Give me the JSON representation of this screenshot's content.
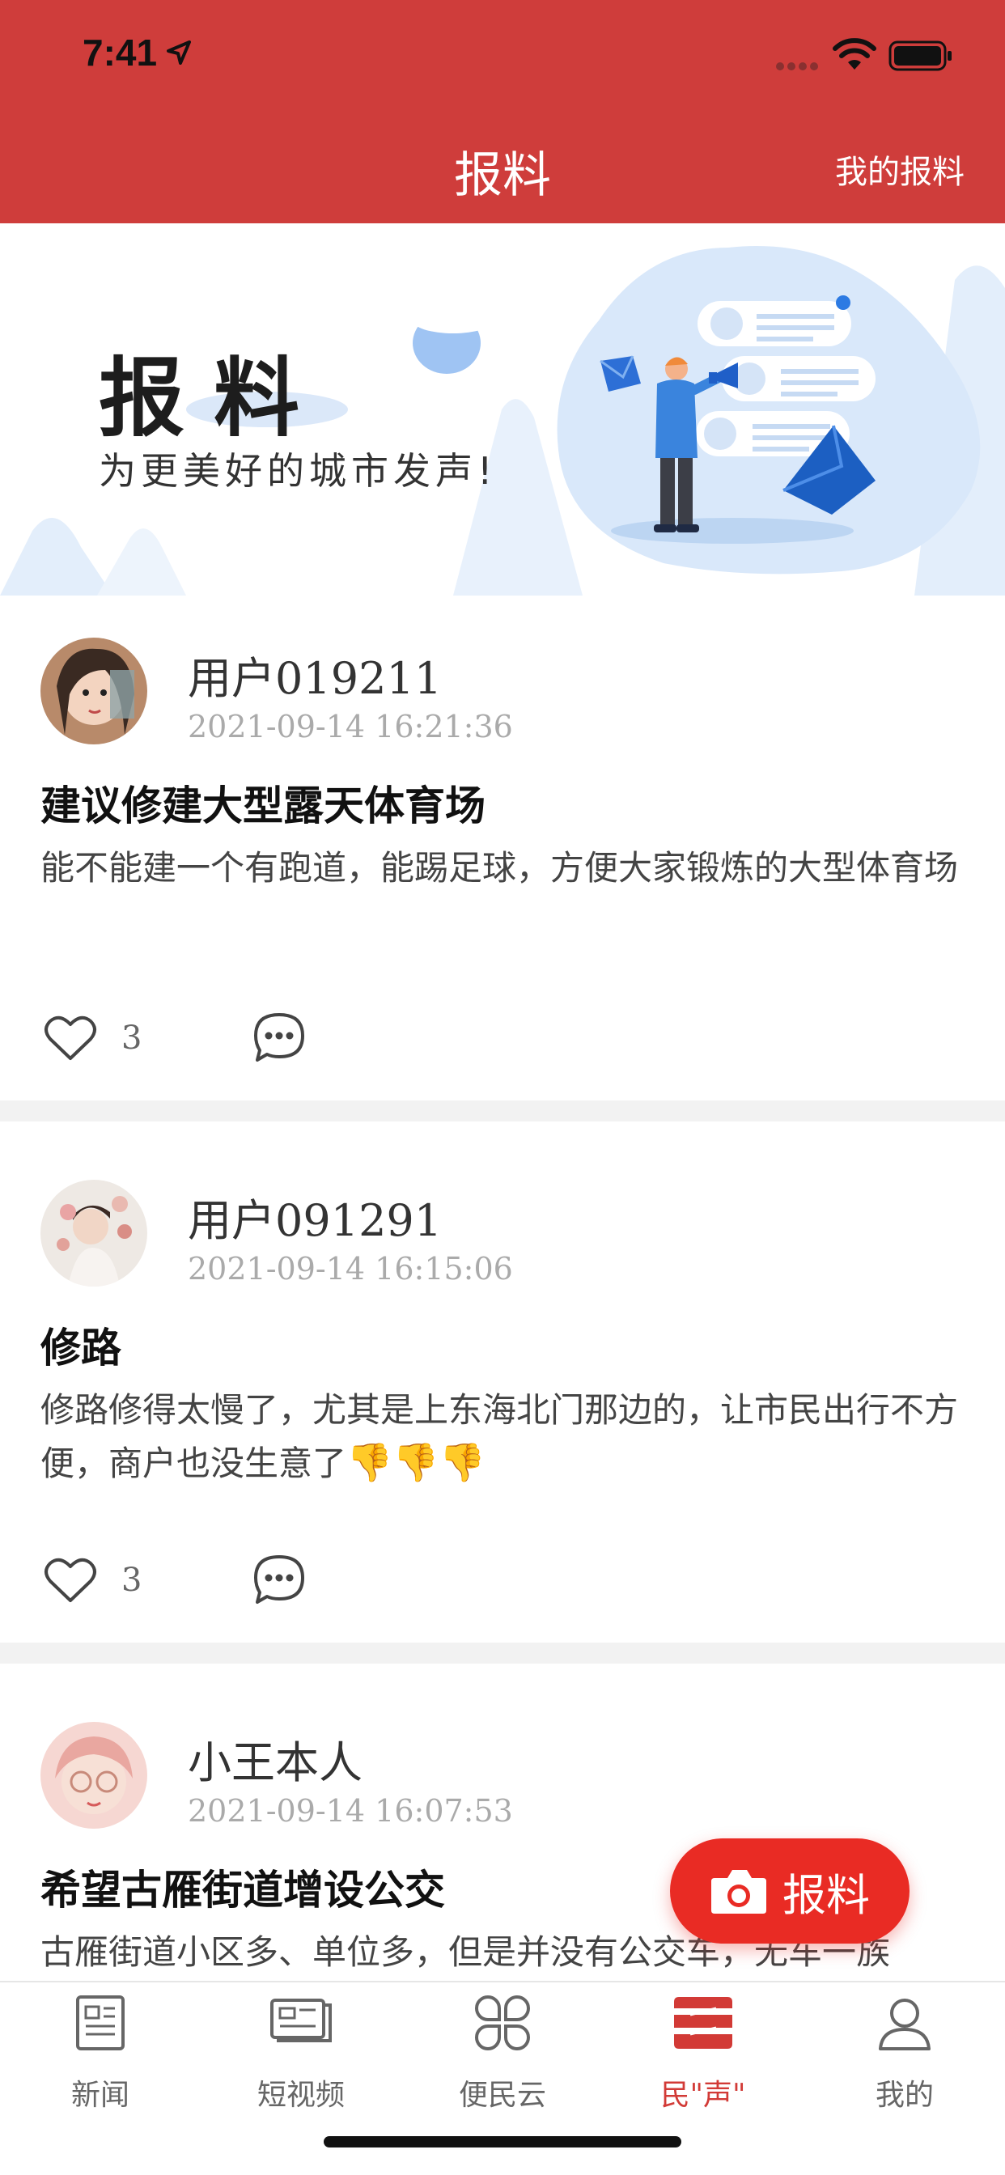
{
  "status_bar": {
    "time": "7:41"
  },
  "nav": {
    "title": "报料",
    "right_link": "我的报料"
  },
  "banner": {
    "title": "报料",
    "subtitle": "为更美好的城市发声!"
  },
  "posts": [
    {
      "user": "用户019211",
      "time": "2021-09-14 16:21:36",
      "title": "建议修建大型露天体育场",
      "body": "能不能建一个有跑道，能踢足球，方便大家锻炼的大型体育场",
      "likes": "3"
    },
    {
      "user": "用户091291",
      "time": "2021-09-14 16:15:06",
      "title": "修路",
      "body": "修路修得太慢了，尤其是上东海北门那边的，让市民出行不方便，商户也没生意了",
      "emoji": "👎👎👎",
      "likes": "3"
    },
    {
      "user": "小王本人",
      "time": "2021-09-14 16:07:53",
      "title": "希望古雁街道增设公交",
      "body": "古雁街道小区多、单位多，但是并没有公交车，无车一族"
    }
  ],
  "fab": {
    "label": "报料"
  },
  "tabs": [
    {
      "label": "新闻",
      "icon": "news-icon"
    },
    {
      "label": "短视频",
      "icon": "video-icon"
    },
    {
      "label": "便民云",
      "icon": "grid-icon"
    },
    {
      "label": "民\"声\"",
      "icon": "voice-icon"
    },
    {
      "label": "我的",
      "icon": "user-icon"
    }
  ],
  "colors": {
    "header": "#cf3d3b",
    "accent": "#e92b24",
    "active_tab": "#d23a36"
  }
}
